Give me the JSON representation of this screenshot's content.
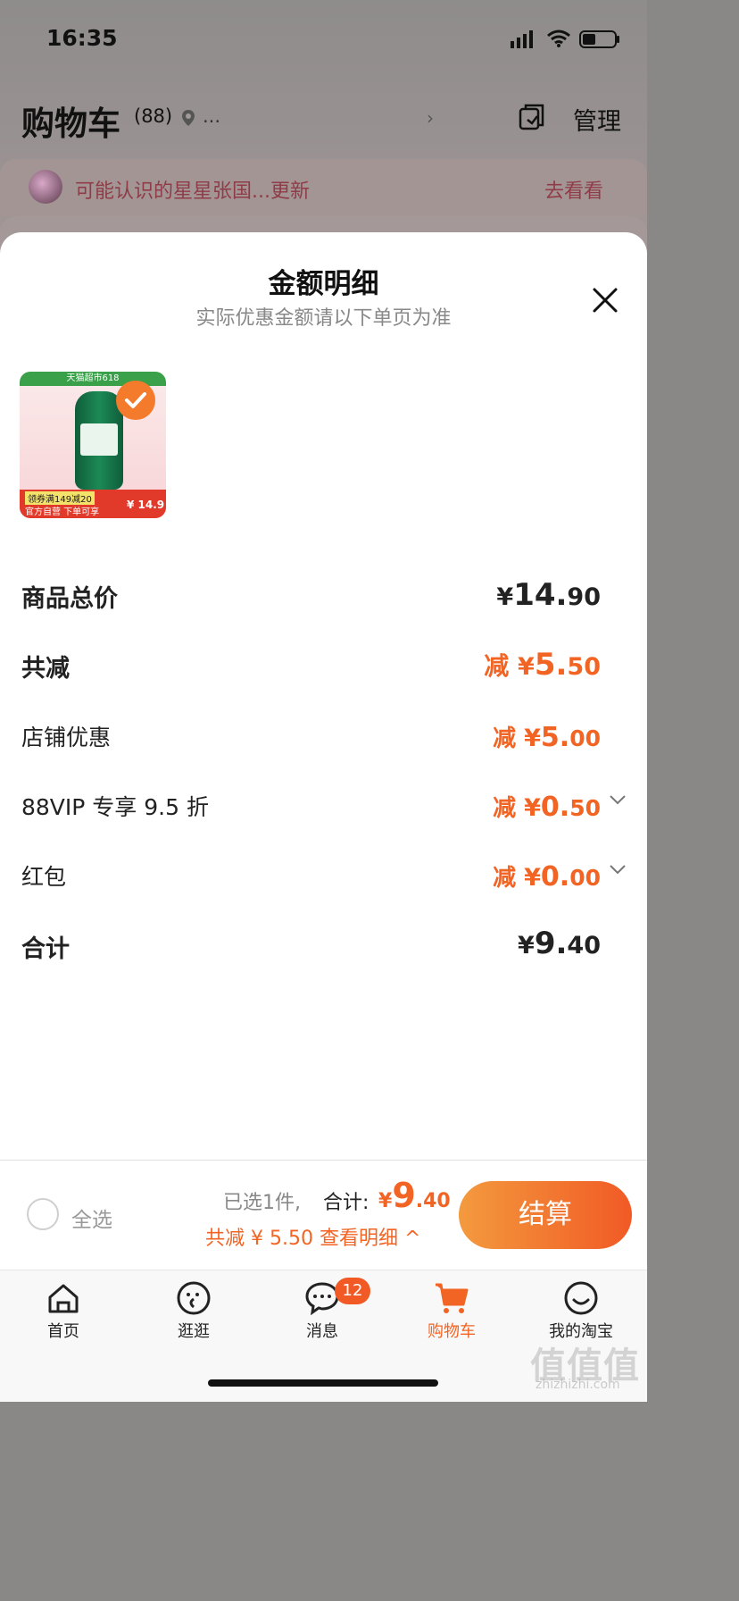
{
  "status_bar": {
    "time": "16:35"
  },
  "header": {
    "title": "购物车",
    "count": "(88)",
    "location": "...",
    "manage_label": "管理"
  },
  "notice": {
    "text": "可能认识的星星张国...更新",
    "link": "去看看"
  },
  "sheet": {
    "title": "金额明细",
    "subtitle": "实际优惠金额请以下单页为准",
    "product": {
      "banner": "天猫超市618",
      "deal": "领券满149减20",
      "footer": "官方自营 下单可享",
      "price": "¥ 14.9"
    },
    "rows": [
      {
        "label": "商品总价",
        "prefix": "",
        "yen": "¥",
        "int": "14.",
        "dec": "90"
      },
      {
        "label": "共减",
        "prefix": "减 ",
        "yen": "¥",
        "int": "5.",
        "dec": "50"
      },
      {
        "label": "店铺优惠",
        "prefix": "减 ",
        "yen": "¥",
        "int": "5.",
        "dec": "00"
      },
      {
        "label": "88VIP 专享 9.5 折",
        "prefix": "减 ",
        "yen": "¥",
        "int": "0.",
        "dec": "50"
      },
      {
        "label": "红包",
        "prefix": "减 ",
        "yen": "¥",
        "int": "0.",
        "dec": "00"
      },
      {
        "label": "合计",
        "prefix": "",
        "yen": "¥",
        "int": "9.",
        "dec": "40"
      }
    ]
  },
  "checkout": {
    "select_all": "全选",
    "selected": "已选1件,",
    "total_label": "合计:",
    "total_yen": "¥",
    "total_int": "9",
    "total_dec": ".40",
    "discount": "共减 ¥ 5.50  查看明细 ^",
    "button": "结算"
  },
  "tabs": [
    {
      "label": "首页"
    },
    {
      "label": "逛逛"
    },
    {
      "label": "消息",
      "badge": "12"
    },
    {
      "label": "购物车"
    },
    {
      "label": "我的淘宝"
    }
  ],
  "watermark": {
    "main": "值值值",
    "sub": "zhizhizhi.com"
  },
  "colors": {
    "accent": "#f26424",
    "checkout_start": "#f39a3e",
    "checkout_end": "#f15a25"
  }
}
